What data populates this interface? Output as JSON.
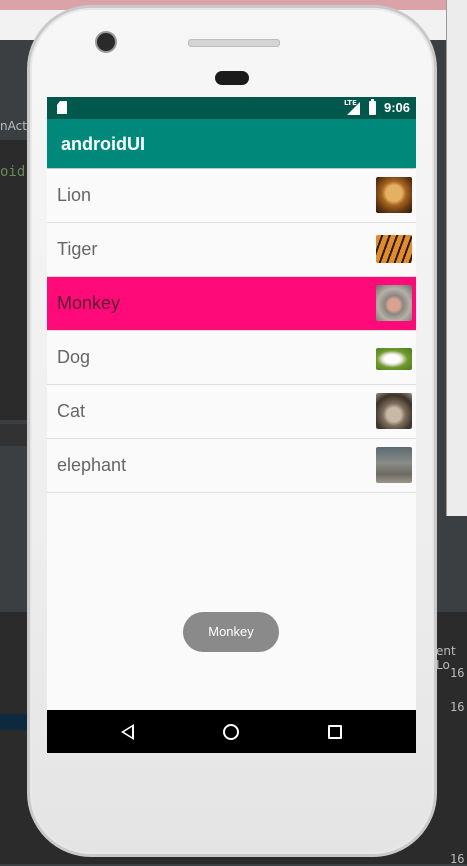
{
  "ide": {
    "tab_label": "nActi",
    "code_snippet": "oid",
    "event_log_label": "ent Lo",
    "times": [
      "16:",
      "16:",
      "16:"
    ]
  },
  "device": {
    "status_bar": {
      "network": "LTE",
      "time": "9:06"
    },
    "app_bar": {
      "title": "androidUI"
    },
    "list": {
      "selected_index": 2,
      "items": [
        {
          "label": "Lion",
          "thumbnail": "lion-photo"
        },
        {
          "label": "Tiger",
          "thumbnail": "tiger-photo"
        },
        {
          "label": "Monkey",
          "thumbnail": "monkey-photo"
        },
        {
          "label": "Dog",
          "thumbnail": "dog-photo"
        },
        {
          "label": "Cat",
          "thumbnail": "cat-photo"
        },
        {
          "label": "elephant",
          "thumbnail": "elephant-photo"
        }
      ]
    },
    "toast": {
      "text": "Monkey"
    },
    "colors": {
      "status_bar": "#00574b",
      "app_bar": "#00897b",
      "selected_row": "#ff0a78",
      "toast": "#8a8a8a"
    }
  }
}
